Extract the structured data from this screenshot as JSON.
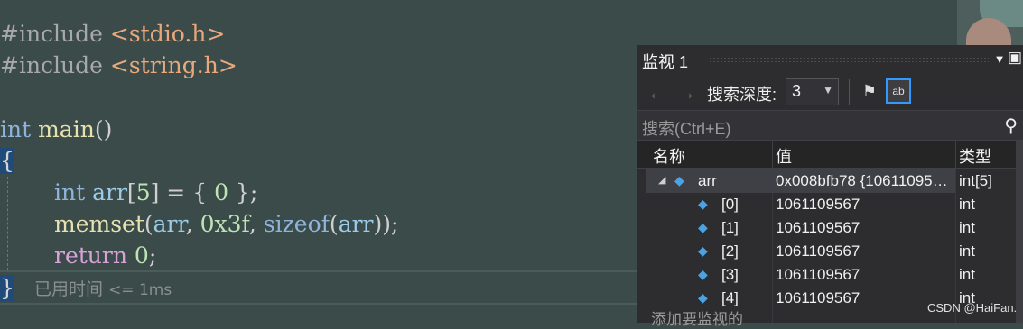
{
  "editor": {
    "lines": [
      {
        "pre": "#include",
        "rest": " <stdio.h>"
      },
      {
        "pre": "#include",
        "rest": " <string.h>"
      }
    ],
    "main_kw": "int",
    "main_fn": " main",
    "main_paren": "()",
    "open_brace": "{",
    "decl": {
      "kw": "int",
      "name": " arr",
      "br1": "[",
      "num": "5",
      "br2": "]",
      "eq": " = { ",
      "zero": "0",
      "end": " };"
    },
    "memset": {
      "fn": "memset",
      "p1": "(",
      "arg1": "arr",
      "comma1": ", ",
      "hex": "0x3f",
      "comma2": ", ",
      "sizeof": "sizeof",
      "p2": "(",
      "arg2": "arr",
      "p3": "));"
    },
    "ret": {
      "kw": "return",
      "num": " 0",
      "end": ";"
    },
    "close_brace": "}",
    "elapsed_label": "已用时间",
    "elapsed_value": "<= 1ms"
  },
  "watch": {
    "title": "监视 1",
    "depth_label": "搜索深度:",
    "depth_value": "3",
    "search_placeholder": "搜索(Ctrl+E)",
    "headers": {
      "name": "名称",
      "value": "值",
      "type": "类型"
    },
    "root": {
      "name": "arr",
      "value": "0x008bfb78 {10611095…",
      "type": "int[5]"
    },
    "items": [
      {
        "name": "[0]",
        "value": "1061109567",
        "type": "int"
      },
      {
        "name": "[1]",
        "value": "1061109567",
        "type": "int"
      },
      {
        "name": "[2]",
        "value": "1061109567",
        "type": "int"
      },
      {
        "name": "[3]",
        "value": "1061109567",
        "type": "int"
      },
      {
        "name": "[4]",
        "value": "1061109567",
        "type": "int"
      }
    ],
    "add_placeholder": "添加要监视的"
  },
  "icons": [
    "left-arrow-icon",
    "right-arrow-icon",
    "dropdown-icon",
    "pin-icon",
    "view-icon",
    "search-icon",
    "cube-icon",
    "expand-icon",
    "close-icon",
    "maximize-icon"
  ],
  "watermark": "CSDN @HaiFan."
}
